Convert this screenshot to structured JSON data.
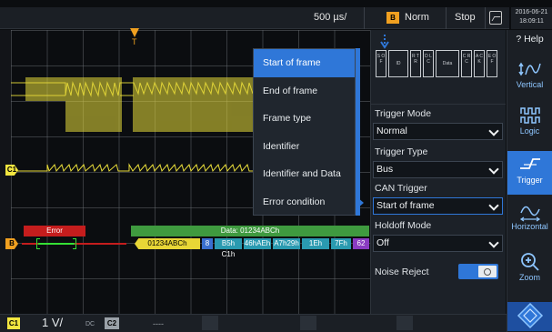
{
  "topbar": {
    "timebase": "500 µs/",
    "trigger_badge": "B",
    "trigger_mode_label": "Norm",
    "run_state": "Stop",
    "date": "2016-06-21",
    "time": "18:09:11"
  },
  "waveform": {
    "trigger_marker": "T",
    "channel_marker": "C1",
    "bus_marker": "B"
  },
  "decode": {
    "error_label": "Error",
    "data_header": "Data: 01234ABCh",
    "id": "01234ABCh",
    "dlc": "8",
    "bytes": [
      "B5h",
      "C1h",
      "46h",
      "AEh",
      "A7h",
      "29h",
      "1Eh",
      "7Fh"
    ],
    "crc": "62",
    "byte_pairs": [
      "B5h C1h",
      "46hAEh",
      "A7h29h",
      "1Eh",
      "7Fh"
    ]
  },
  "menu": {
    "items": [
      "Start of frame",
      "End of frame",
      "Frame type",
      "Identifier",
      "Identifier and Data",
      "Error condition"
    ],
    "selected_index": 0
  },
  "frame_diagram": {
    "fields": [
      "S O F",
      "ID",
      "R T R",
      "D L C",
      "Data",
      "C R C",
      "A C K",
      "E O F"
    ]
  },
  "panel": {
    "trigger_mode_label": "Trigger Mode",
    "trigger_mode_value": "Normal",
    "trigger_type_label": "Trigger Type",
    "trigger_type_value": "Bus",
    "can_trigger_label": "CAN Trigger",
    "can_trigger_value": "Start of frame",
    "holdoff_mode_label": "Holdoff Mode",
    "holdoff_mode_value": "Off",
    "noise_reject_label": "Noise Reject",
    "noise_reject_on": true
  },
  "sidebar": {
    "help": "? Help",
    "vertical": "Vertical",
    "logic": "Logic",
    "trigger": "Trigger",
    "horizontal": "Horizontal",
    "zoom": "Zoom"
  },
  "bottombar": {
    "c1_badge": "C1",
    "c1_scale": "1 V/",
    "c1_coupling": "DC",
    "c2_badge": "C2",
    "c2_scale": "----"
  },
  "colors": {
    "accent": "#2f77d8",
    "channel1": "#f2e640",
    "bus": "#f0a020",
    "error": "#c51d1d",
    "data": "#3f9a3f"
  }
}
